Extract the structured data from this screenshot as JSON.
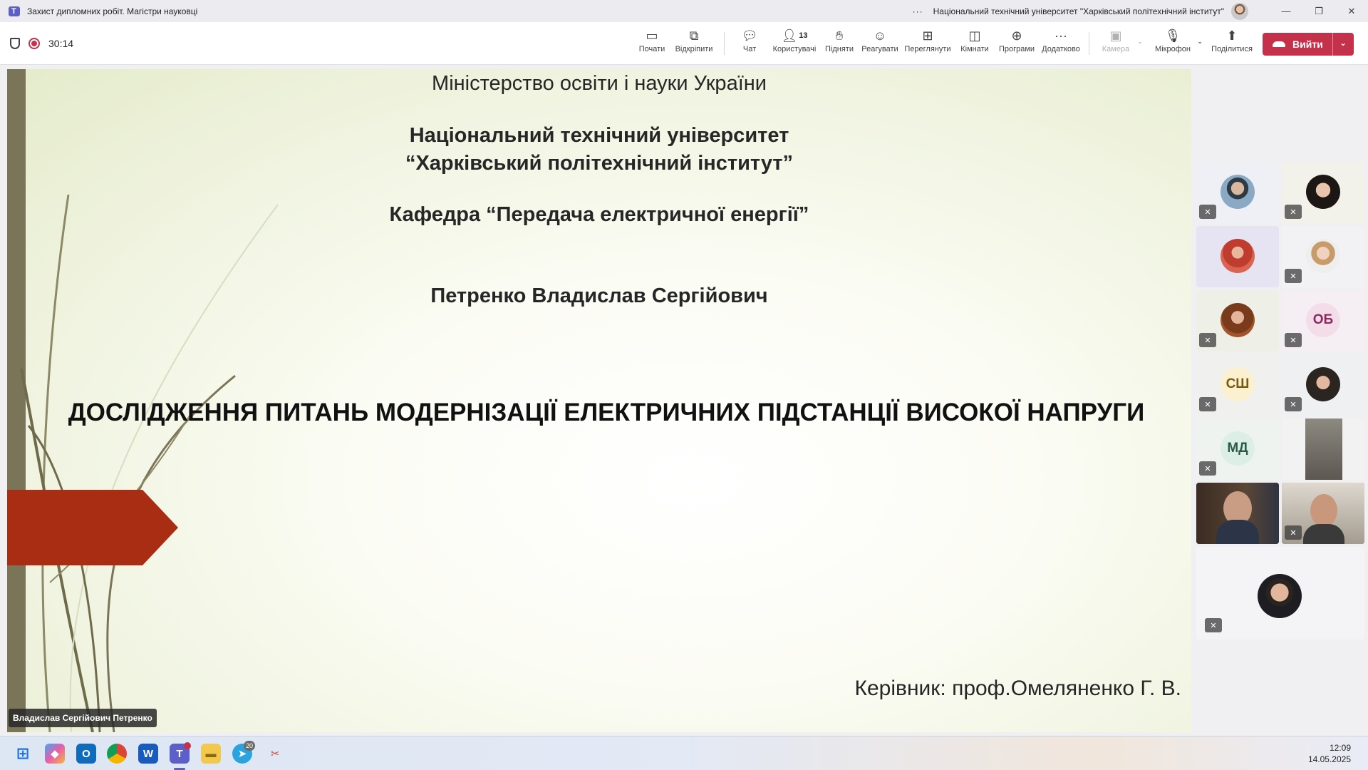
{
  "window": {
    "title": "Захист дипломних робіт. Магістри науковці",
    "organization": "Національний технічний університет \"Харківський політехнічний інститут\"",
    "controls": [
      "—",
      "❐",
      "✕"
    ]
  },
  "meeting": {
    "timer": "30:14",
    "participants_count": "13",
    "toolbar": {
      "start": "Почати",
      "popout": "Відкріпити",
      "chat": "Чат",
      "people": "Користувачі",
      "raise": "Підняти",
      "react": "Реагувати",
      "view": "Переглянути",
      "rooms": "Кімнати",
      "apps": "Програми",
      "more": "Додатково",
      "camera": "Камера",
      "mic": "Мікрофон",
      "share": "Поділитися",
      "leave": "Вийти"
    }
  },
  "slide": {
    "ministry": "Міністерство освіти і науки України",
    "university_line1": "Національний технічний університет",
    "university_line2": "“Харківський політехнічний інститут”",
    "department": "Кафедра “Передача електричної енергії”",
    "author": "Петренко Владислав Сергійович",
    "topic": "ДОСЛІДЖЕННЯ ПИТАНЬ МОДЕРНІЗАЦІЇ ЕЛЕКТРИЧНИХ ПІДСТАНЦІЇ ВИСОКОЇ НАПРУГИ",
    "supervisor": "Керівник: проф.Омеляненко Г. В.",
    "presenter_tag": "Владислав Сергійович Петренко"
  },
  "participants": [
    {
      "initials": "",
      "kind": "photo",
      "muted": true
    },
    {
      "initials": "",
      "kind": "photo",
      "muted": true
    },
    {
      "initials": "",
      "kind": "photo",
      "muted": false
    },
    {
      "initials": "",
      "kind": "photo",
      "muted": true
    },
    {
      "initials": "",
      "kind": "photo",
      "muted": true
    },
    {
      "initials": "ОБ",
      "kind": "initials",
      "muted": true
    },
    {
      "initials": "СШ",
      "kind": "initials",
      "muted": true
    },
    {
      "initials": "",
      "kind": "photo",
      "muted": true
    },
    {
      "initials": "МД",
      "kind": "initials",
      "muted": true
    },
    {
      "initials": "",
      "kind": "video",
      "muted": false
    },
    {
      "initials": "",
      "kind": "video",
      "muted": false
    },
    {
      "initials": "",
      "kind": "video",
      "muted": true
    },
    {
      "initials": "",
      "kind": "photo",
      "muted": true
    }
  ],
  "taskbar": {
    "telegram_badge": "20",
    "time": "12:09",
    "date": "14.05.2025"
  },
  "colors": {
    "leave": "#c4314b",
    "slide_accent": "#a82d12",
    "slide_bar": "#7a7458",
    "teams": "#5b5fc7"
  }
}
